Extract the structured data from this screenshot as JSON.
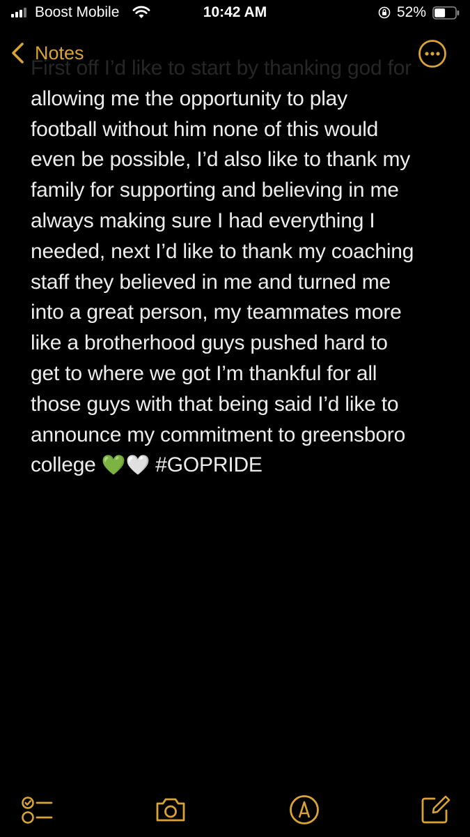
{
  "status_bar": {
    "carrier": "Boost Mobile",
    "time": "10:42 AM",
    "battery_percent": "52%",
    "battery_level": 0.52
  },
  "nav": {
    "back_label": "Notes",
    "more_icon": "ellipsis-circle-icon"
  },
  "note": {
    "first_line": "First off I’d like to start by thanking god for",
    "body": "allowing me the opportunity to play\nfootball without him none of this would\neven be possible, I’d also like to thank my\nfamily for supporting and believing in me\nalways making sure I had everything I\nneeded, next I’d like to thank my coaching\nstaff they believed in me and turned me\ninto a great person, my teammates more\nlike a brotherhood guys pushed hard to\nget to where we got I’m thankful for all\nthose guys with that being said I’d like to\nannounce my commitment to greensboro\ncollege",
    "emoji_green_heart": "💚",
    "emoji_white_heart": "🤍",
    "hashtag": "#GOPRIDE"
  },
  "toolbar": {
    "items": [
      "checklist-icon",
      "camera-icon",
      "markup-icon",
      "compose-icon"
    ]
  },
  "colors": {
    "accent": "#d9a434",
    "background": "#000000",
    "text": "#ededed"
  }
}
